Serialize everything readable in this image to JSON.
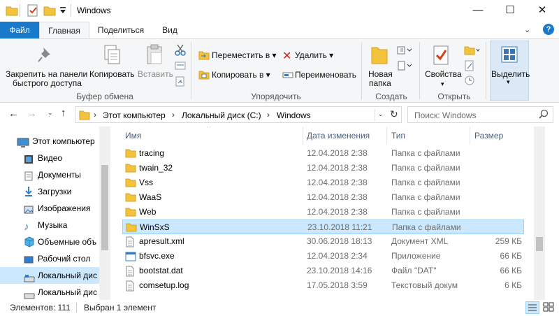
{
  "window": {
    "title": "Windows"
  },
  "controls": {
    "minimize": "—",
    "maximize": "☐",
    "close": "✕"
  },
  "tabs": [
    {
      "label": "Файл"
    },
    {
      "label": "Главная"
    },
    {
      "label": "Поделиться"
    },
    {
      "label": "Вид"
    }
  ],
  "ribbon": {
    "clipboard": {
      "pin_line1": "Закрепить на панели",
      "pin_line2": "быстрого доступа",
      "copy": "Копировать",
      "paste": "Вставить",
      "group": "Буфер обмена"
    },
    "organize": {
      "move": "Переместить в ▾",
      "copy_to": "Копировать в ▾",
      "delete": "Удалить ▾",
      "rename": "Переименовать",
      "group": "Упорядочить"
    },
    "new": {
      "line1": "Новая",
      "line2": "папка",
      "group": "Создать"
    },
    "open": {
      "properties": "Свойства",
      "group": "Открыть"
    },
    "select": {
      "label": "Выделить"
    }
  },
  "address": {
    "crumbs": [
      "Этот компьютер",
      "Локальный диск (C:)",
      "Windows"
    ],
    "search_placeholder": "Поиск: Windows"
  },
  "nav": [
    {
      "label": "Этот компьютер",
      "icon": "computer-icon"
    },
    {
      "label": "Видео",
      "icon": "video-icon"
    },
    {
      "label": "Документы",
      "icon": "documents-icon"
    },
    {
      "label": "Загрузки",
      "icon": "downloads-icon"
    },
    {
      "label": "Изображения",
      "icon": "pictures-icon"
    },
    {
      "label": "Музыка",
      "icon": "music-icon"
    },
    {
      "label": "Объемные объ",
      "icon": "3d-objects-icon"
    },
    {
      "label": "Рабочий стол",
      "icon": "desktop-icon"
    },
    {
      "label": "Локальный дис",
      "icon": "drive-icon"
    },
    {
      "label": "Локальный дис",
      "icon": "drive-icon"
    }
  ],
  "columns": {
    "name": "Имя",
    "date": "Дата изменения",
    "type": "Тип",
    "size": "Размер"
  },
  "files": [
    {
      "name": "tracing",
      "date": "12.04.2018 2:38",
      "type": "Папка с файлами",
      "size": "",
      "icon": "folder-icon"
    },
    {
      "name": "twain_32",
      "date": "12.04.2018 2:38",
      "type": "Папка с файлами",
      "size": "",
      "icon": "folder-icon"
    },
    {
      "name": "Vss",
      "date": "12.04.2018 2:38",
      "type": "Папка с файлами",
      "size": "",
      "icon": "folder-icon"
    },
    {
      "name": "WaaS",
      "date": "12.04.2018 2:38",
      "type": "Папка с файлами",
      "size": "",
      "icon": "folder-icon"
    },
    {
      "name": "Web",
      "date": "12.04.2018 2:38",
      "type": "Папка с файлами",
      "size": "",
      "icon": "folder-icon"
    },
    {
      "name": "WinSxS",
      "date": "23.10.2018 11:21",
      "type": "Папка с файлами",
      "size": "",
      "icon": "folder-icon"
    },
    {
      "name": "apresult.xml",
      "date": "30.06.2018 18:13",
      "type": "Документ XML",
      "size": "259 КБ",
      "icon": "file-icon"
    },
    {
      "name": "bfsvc.exe",
      "date": "12.04.2018 2:34",
      "type": "Приложение",
      "size": "66 КБ",
      "icon": "exe-icon"
    },
    {
      "name": "bootstat.dat",
      "date": "23.10.2018 14:16",
      "type": "Файл \"DAT\"",
      "size": "66 КБ",
      "icon": "file-icon"
    },
    {
      "name": "comsetup.log",
      "date": "17.05.2018 3:59",
      "type": "Текстовый докум",
      "size": "6 КБ",
      "icon": "file-icon"
    }
  ],
  "selected_file": "WinSxS",
  "status": {
    "count": "Элементов: 111",
    "selected": "Выбран 1 элемент"
  },
  "colors": {
    "file_tab": "#1979ca",
    "folder": "#f3c33b",
    "selection": "#cce8ff",
    "selection_border": "#99d1ff",
    "nav_selected": "#cce8ff"
  }
}
